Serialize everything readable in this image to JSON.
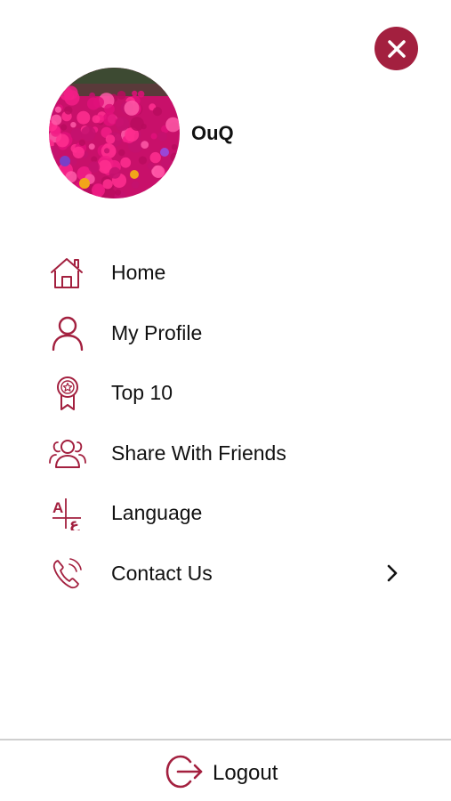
{
  "colors": {
    "accent": "#a3203f",
    "text": "#111111",
    "divider": "#cfcfcf",
    "background": "#ffffff"
  },
  "header": {
    "close_icon": "close-icon",
    "username": "OuQ",
    "avatar_alt": "flowers"
  },
  "menu": {
    "items": [
      {
        "label": "Home",
        "icon": "home-icon"
      },
      {
        "label": "My Profile",
        "icon": "user-icon"
      },
      {
        "label": "Top 10",
        "icon": "award-ribbon-icon"
      },
      {
        "label": "Share With Friends",
        "icon": "friends-icon"
      },
      {
        "label": "Language",
        "icon": "language-icon"
      },
      {
        "label": "Contact Us",
        "icon": "phone-icon",
        "has_chevron": true
      }
    ]
  },
  "footer": {
    "logout_label": "Logout",
    "logout_icon": "logout-icon"
  }
}
